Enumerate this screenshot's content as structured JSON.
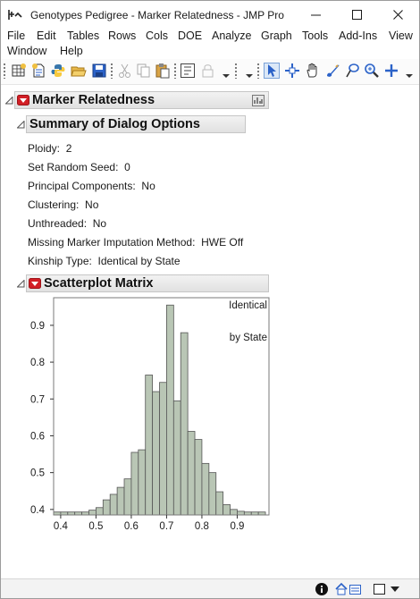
{
  "window": {
    "title": "Genotypes Pedigree - Marker Relatedness - JMP Pro"
  },
  "window_controls": [
    "minimize-icon",
    "maximize-icon",
    "close-icon"
  ],
  "menu": {
    "row1": [
      "File",
      "Edit",
      "Tables",
      "Rows",
      "Cols",
      "DOE",
      "Analyze",
      "Graph",
      "Tools",
      "Add-Ins",
      "View"
    ],
    "row2": [
      "Window",
      "Help"
    ]
  },
  "toolbar": {
    "icons": [
      "new-data-table-icon",
      "new-script-icon",
      "python-icon",
      "open-file-icon",
      "save-icon",
      "cut-icon",
      "copy-icon",
      "paste-icon",
      "run-script-icon",
      "lock-icon",
      "arrow-tool-icon",
      "crosshair-tool-icon",
      "hand-tool-icon",
      "brush-tool-icon",
      "lasso-tool-icon",
      "magnifier-icon",
      "plus-tool-icon"
    ]
  },
  "report": {
    "title": "Marker Relatedness",
    "summary_title": "Summary of Dialog Options",
    "options": [
      {
        "label": "Ploidy:",
        "value": "2"
      },
      {
        "label": "Set Random Seed:",
        "value": "0"
      },
      {
        "label": "Principal Components:",
        "value": "No"
      },
      {
        "label": "Clustering:",
        "value": "No"
      },
      {
        "label": "Unthreaded:",
        "value": "No"
      },
      {
        "label": "Missing Marker Imputation Method:",
        "value": "HWE Off"
      },
      {
        "label": "Kinship Type:",
        "value": "Identical by State"
      }
    ],
    "scatter_title": "Scatterplot Matrix"
  },
  "chart_data": {
    "type": "bar",
    "title": "Identical by State",
    "xlim": [
      0.38,
      0.99
    ],
    "ylim": [
      0.385,
      0.975
    ],
    "x_ticks": [
      "0.4",
      "0.5",
      "0.6",
      "0.7",
      "0.8",
      "0.9"
    ],
    "y_ticks": [
      "0.4",
      "0.5",
      "0.6",
      "0.7",
      "0.8",
      "0.9"
    ],
    "bin_width": 0.02,
    "bin_starts": [
      0.38,
      0.4,
      0.42,
      0.44,
      0.46,
      0.48,
      0.5,
      0.52,
      0.54,
      0.56,
      0.58,
      0.6,
      0.62,
      0.64,
      0.66,
      0.68,
      0.7,
      0.72,
      0.74,
      0.76,
      0.78,
      0.8,
      0.82,
      0.84,
      0.86,
      0.88,
      0.9,
      0.92,
      0.94,
      0.96
    ],
    "bar_tops": [
      0.393,
      0.393,
      0.393,
      0.393,
      0.393,
      0.398,
      0.405,
      0.426,
      0.441,
      0.46,
      0.483,
      0.555,
      0.562,
      0.765,
      0.72,
      0.745,
      0.955,
      0.695,
      0.88,
      0.612,
      0.59,
      0.525,
      0.5,
      0.448,
      0.413,
      0.4,
      0.395,
      0.393,
      0.393,
      0.393
    ],
    "bar_color": "#b9c6b5",
    "grid": false
  },
  "statusbar": {
    "icons": [
      "info-icon",
      "home-icon",
      "window-list-icon",
      "blank-window-icon",
      "dropdown-icon"
    ]
  },
  "colors": {
    "red_triangle": "#d21f26",
    "header_gradient_top": "#f2f2f2",
    "header_gradient_bottom": "#e1e1e1",
    "toolbar_blue": "#2b62c8"
  }
}
